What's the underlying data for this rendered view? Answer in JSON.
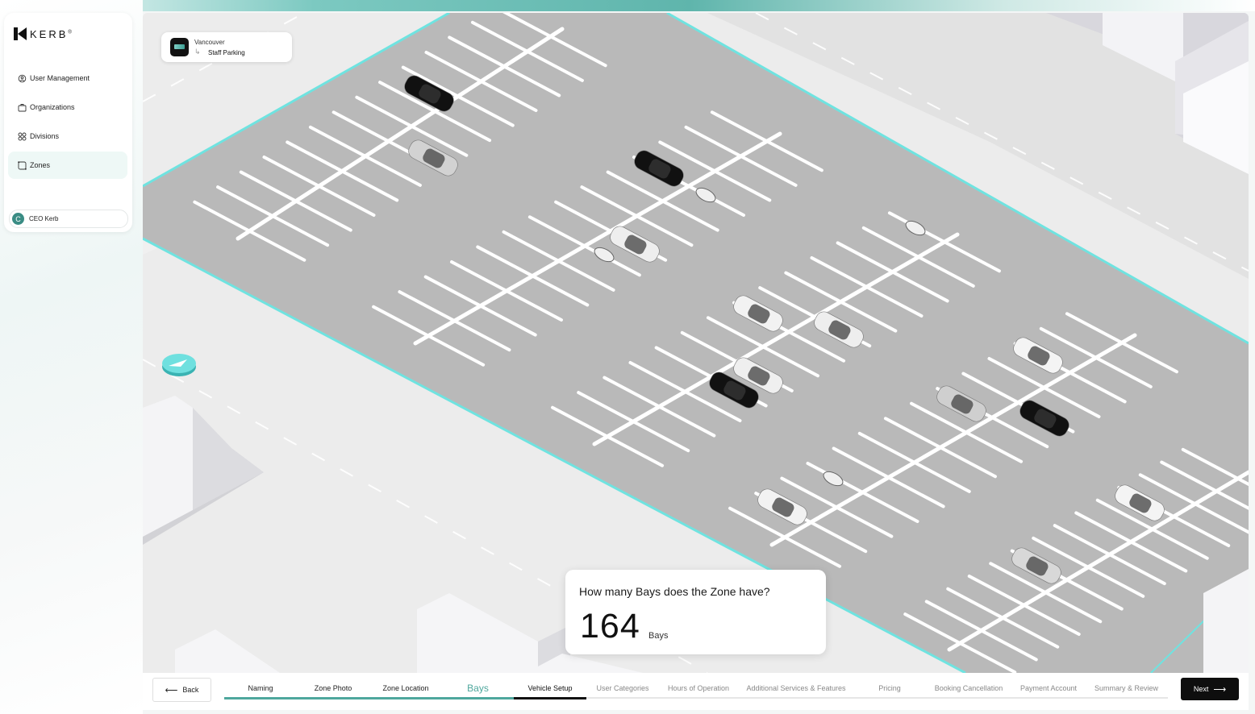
{
  "brand": {
    "name": "KERB",
    "mark": "®"
  },
  "sidebar": {
    "items": [
      {
        "label": "User Management",
        "icon": "user-gear-icon",
        "active": false
      },
      {
        "label": "Organizations",
        "icon": "briefcase-icon",
        "active": false
      },
      {
        "label": "Divisions",
        "icon": "grid-circles-icon",
        "active": false
      },
      {
        "label": "Zones",
        "icon": "zone-icon",
        "active": true
      }
    ],
    "user": {
      "initial": "C",
      "name": "CEO Kerb"
    }
  },
  "breadcrumb": {
    "city": "Vancouver",
    "arrow": "↳",
    "zone": "Staff Parking"
  },
  "question": {
    "text": "How many Bays does the Zone have?",
    "value": "164",
    "unit": "Bays"
  },
  "wizard": {
    "back_label": "Back",
    "next_label": "Next",
    "steps": [
      {
        "label": "Naming",
        "state": "done"
      },
      {
        "label": "Zone Photo",
        "state": "done"
      },
      {
        "label": "Zone Location",
        "state": "done"
      },
      {
        "label": "Bays",
        "state": "current"
      },
      {
        "label": "Vehicle Setup",
        "state": "next"
      },
      {
        "label": "User Categories",
        "state": "todo"
      },
      {
        "label": "Hours of Operation",
        "state": "todo"
      },
      {
        "label": "Additional Services & Features",
        "state": "todo"
      },
      {
        "label": "Pricing",
        "state": "todo"
      },
      {
        "label": "Booking Cancellation",
        "state": "todo"
      },
      {
        "label": "Payment Account",
        "state": "todo"
      },
      {
        "label": "Summary & Review",
        "state": "todo"
      }
    ]
  },
  "colors": {
    "accent": "#4ea79d",
    "zone_outline": "#6fe3e0",
    "asphalt": "#b9b9b9",
    "dark": "#0e0e0e"
  }
}
